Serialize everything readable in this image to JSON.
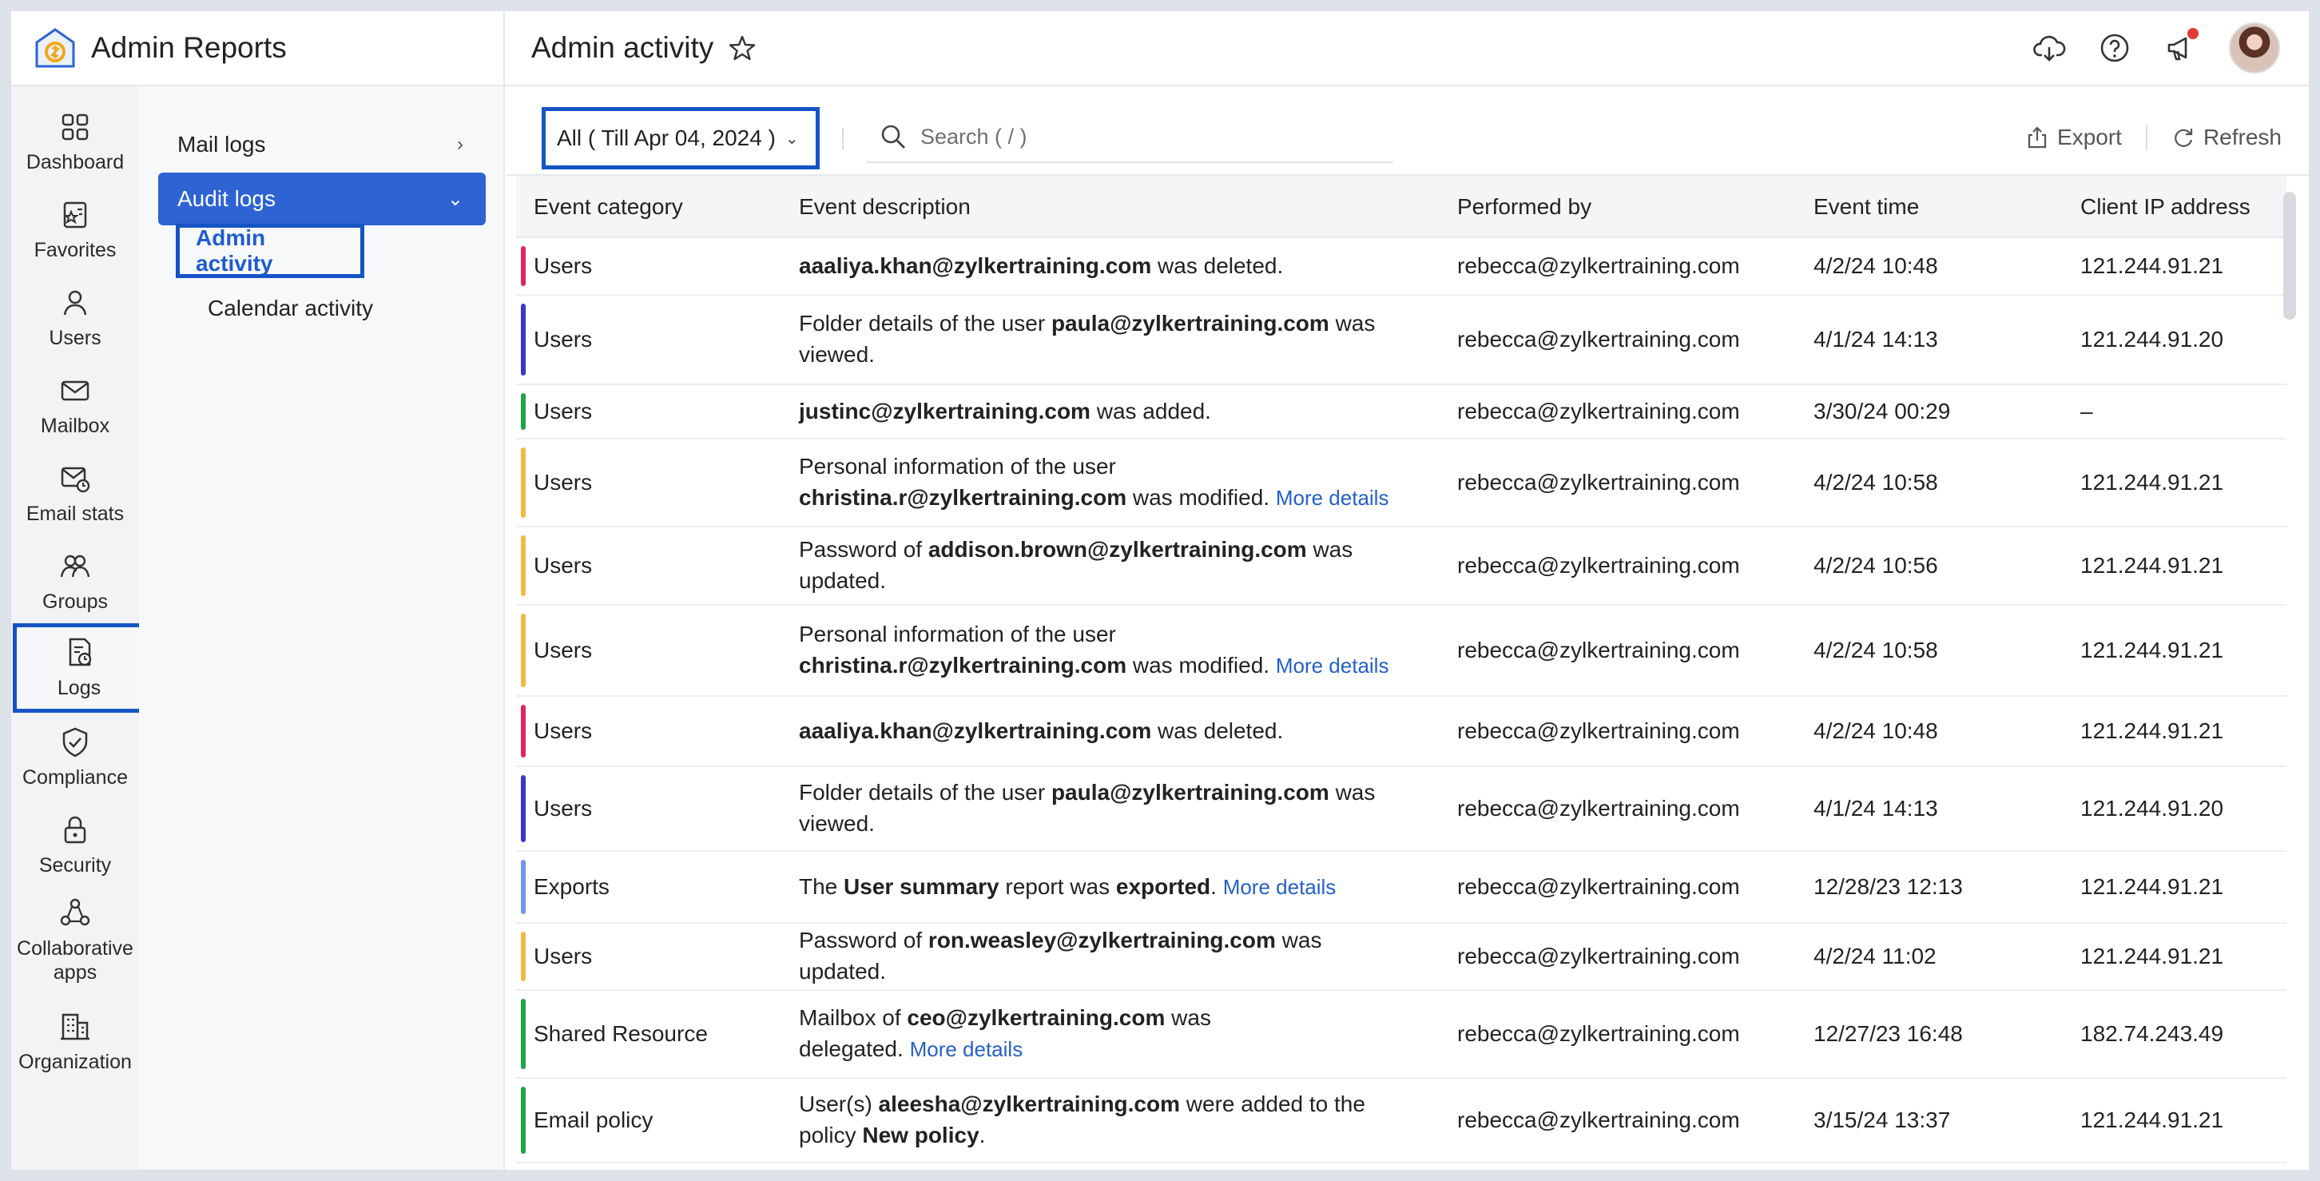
{
  "app": {
    "title": "Admin Reports"
  },
  "header": {
    "page_title": "Admin activity"
  },
  "rail": [
    {
      "label": "Dashboard",
      "icon": "grid-icon"
    },
    {
      "label": "Favorites",
      "icon": "star-list-icon"
    },
    {
      "label": "Users",
      "icon": "user-icon"
    },
    {
      "label": "Mailbox",
      "icon": "envelope-icon"
    },
    {
      "label": "Email stats",
      "icon": "mail-stats-icon"
    },
    {
      "label": "Groups",
      "icon": "groups-icon"
    },
    {
      "label": "Logs",
      "icon": "logs-icon",
      "selected": true
    },
    {
      "label": "Compliance",
      "icon": "shield-check-icon"
    },
    {
      "label": "Security",
      "icon": "lock-icon"
    },
    {
      "label": "Collaborative apps",
      "icon": "apps-icon"
    },
    {
      "label": "Organization",
      "icon": "building-icon"
    }
  ],
  "submenu": {
    "mail_logs": "Mail logs",
    "audit_logs": "Audit logs",
    "admin_activity": "Admin activity",
    "calendar_activity": "Calendar activity"
  },
  "toolbar": {
    "filter": "All ( Till Apr 04, 2024 )",
    "search_placeholder": "Search ( / )",
    "export": "Export",
    "refresh": "Refresh"
  },
  "table": {
    "columns": [
      "Event category",
      "Event description",
      "Performed by",
      "Event time",
      "Client IP address"
    ],
    "rows": [
      {
        "category": "Users",
        "color": "#e0245e",
        "desc": [
          [
            "b",
            "aaaliya.khan@zylkertraining.com"
          ],
          [
            "t",
            " was deleted."
          ]
        ],
        "by": "rebecca@zylkertraining.com",
        "time": "4/2/24 10:48",
        "ip": "121.244.91.21"
      },
      {
        "category": "Users",
        "color": "#3d35c7",
        "desc": [
          [
            "t",
            "Folder details of the user "
          ],
          [
            "b",
            "paula@zylkertraining.com"
          ],
          [
            "t",
            " was viewed."
          ]
        ],
        "by": "rebecca@zylkertraining.com",
        "time": "4/1/24 14:13",
        "ip": "121.244.91.20"
      },
      {
        "category": "Users",
        "color": "#1fa24a",
        "desc": [
          [
            "b",
            "justinc@zylkertraining.com"
          ],
          [
            "t",
            " was added."
          ]
        ],
        "by": "rebecca@zylkertraining.com",
        "time": "3/30/24 00:29",
        "ip": "–"
      },
      {
        "category": "Users",
        "color": "#f5b942",
        "desc": [
          [
            "t",
            "Personal information of the user "
          ],
          [
            "br",
            ""
          ],
          [
            "b",
            "christina.r@zylkertraining.com"
          ],
          [
            "t",
            " was modified. "
          ],
          [
            "m",
            "More details"
          ]
        ],
        "by": "rebecca@zylkertraining.com",
        "time": "4/2/24 10:58",
        "ip": "121.244.91.21"
      },
      {
        "category": "Users",
        "color": "#f5b942",
        "desc": [
          [
            "t",
            "Password of "
          ],
          [
            "b",
            "addison.brown@zylkertraining.com"
          ],
          [
            "t",
            " was updated."
          ]
        ],
        "by": "rebecca@zylkertraining.com",
        "time": "4/2/24 10:56",
        "ip": "121.244.91.21"
      },
      {
        "category": "Users",
        "color": "#f5b942",
        "desc": [
          [
            "t",
            "Personal information of the user "
          ],
          [
            "br",
            ""
          ],
          [
            "b",
            "christina.r@zylkertraining.com"
          ],
          [
            "t",
            " was modified. "
          ],
          [
            "m",
            "More details"
          ]
        ],
        "by": "rebecca@zylkertraining.com",
        "time": "4/2/24 10:58",
        "ip": "121.244.91.21"
      },
      {
        "category": "Users",
        "color": "#e0245e",
        "desc": [
          [
            "b",
            "aaaliya.khan@zylkertraining.com"
          ],
          [
            "t",
            " was deleted."
          ]
        ],
        "by": "rebecca@zylkertraining.com",
        "time": "4/2/24 10:48",
        "ip": "121.244.91.21"
      },
      {
        "category": "Users",
        "color": "#3d35c7",
        "desc": [
          [
            "t",
            "Folder details of the user "
          ],
          [
            "b",
            "paula@zylkertraining.com"
          ],
          [
            "t",
            " was viewed."
          ]
        ],
        "by": "rebecca@zylkertraining.com",
        "time": "4/1/24 14:13",
        "ip": "121.244.91.20"
      },
      {
        "category": "Exports",
        "color": "#6d98e8",
        "desc": [
          [
            "t",
            "The "
          ],
          [
            "b",
            "User summary"
          ],
          [
            "t",
            " report was "
          ],
          [
            "b",
            "exported"
          ],
          [
            "t",
            ". "
          ],
          [
            "m",
            "More details"
          ]
        ],
        "by": "rebecca@zylkertraining.com",
        "time": "12/28/23 12:13",
        "ip": "121.244.91.21"
      },
      {
        "category": "Users",
        "color": "#f5b942",
        "desc": [
          [
            "t",
            "Password of "
          ],
          [
            "b",
            "ron.weasley@zylkertraining.com"
          ],
          [
            "t",
            " was updated."
          ]
        ],
        "by": "rebecca@zylkertraining.com",
        "time": "4/2/24 11:02",
        "ip": "121.244.91.21"
      },
      {
        "category": "Shared Resource",
        "color": "#1fa24a",
        "desc": [
          [
            "t",
            "Mailbox of "
          ],
          [
            "b",
            "ceo@zylkertraining.com"
          ],
          [
            "t",
            " was "
          ],
          [
            "br",
            ""
          ],
          [
            "t",
            "delegated. "
          ],
          [
            "m",
            "More details"
          ]
        ],
        "by": "rebecca@zylkertraining.com",
        "time": "12/27/23 16:48",
        "ip": "182.74.243.49"
      },
      {
        "category": "Email policy",
        "color": "#1fa24a",
        "desc": [
          [
            "t",
            "User(s) "
          ],
          [
            "b",
            "aleesha@zylkertraining.com"
          ],
          [
            "t",
            " were added to the "
          ],
          [
            "br",
            ""
          ],
          [
            "t",
            "policy "
          ],
          [
            "b",
            "New policy"
          ],
          [
            "t",
            "."
          ]
        ],
        "by": "rebecca@zylkertraining.com",
        "time": "3/15/24 13:37",
        "ip": "121.244.91.21"
      }
    ]
  }
}
